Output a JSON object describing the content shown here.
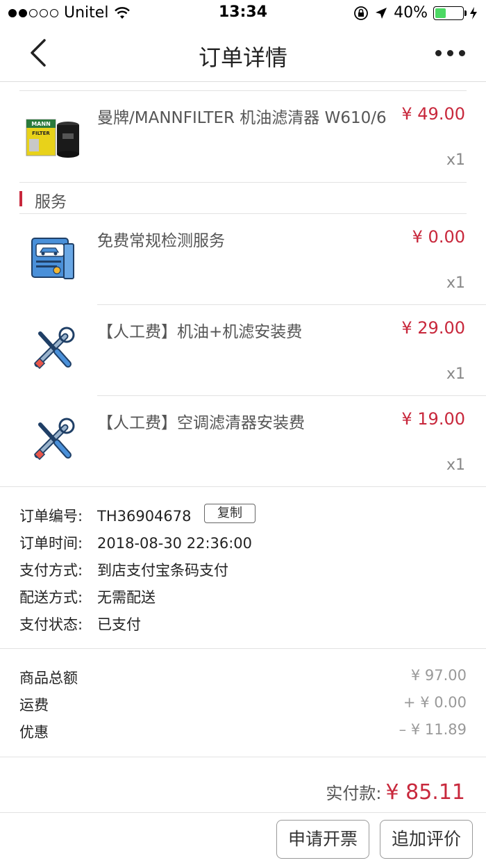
{
  "status_bar": {
    "carrier": "Unitel",
    "time": "13:34",
    "battery": "40%",
    "battery_level": 0.4
  },
  "nav": {
    "title": "订单详情"
  },
  "products": [
    {
      "name": "曼牌/MANNFILTER 机油滤清器 W610/6",
      "price": "¥ 49.00",
      "qty": "x1",
      "icon": "oil-filter-product-image"
    }
  ],
  "services_section": {
    "label": "服务"
  },
  "services": [
    {
      "name": "免费常规检测服务",
      "price": "¥ 0.00",
      "qty": "x1",
      "icon": "car-document-icon"
    },
    {
      "name": "【人工费】机油+机滤安装费",
      "price": "¥ 29.00",
      "qty": "x1",
      "icon": "tools-icon"
    },
    {
      "name": "【人工费】空调滤清器安装费",
      "price": "¥ 19.00",
      "qty": "x1",
      "icon": "tools-icon"
    }
  ],
  "order_info": {
    "number_label": "订单编号:",
    "number": "TH36904678",
    "copy_label": "复制",
    "time_label": "订单时间:",
    "time": "2018-08-30 22:36:00",
    "payment_method_label": "支付方式:",
    "payment_method": "到店支付宝条码支付",
    "delivery_label": "配送方式:",
    "delivery": "无需配送",
    "payment_status_label": "支付状态:",
    "payment_status": "已支付"
  },
  "amounts": {
    "goods_total_label": "商品总额",
    "goods_total": "¥ 97.00",
    "shipping_label": "运费",
    "shipping": "+ ¥ 0.00",
    "discount_label": "优惠",
    "discount": "– ¥ 11.89"
  },
  "total": {
    "label": "实付款:",
    "value": "¥ 85.11"
  },
  "actions": {
    "invoice_label": "申请开票",
    "review_label": "追加评价"
  },
  "colors": {
    "accent": "#c8283c",
    "battery_green": "#4cd964"
  }
}
